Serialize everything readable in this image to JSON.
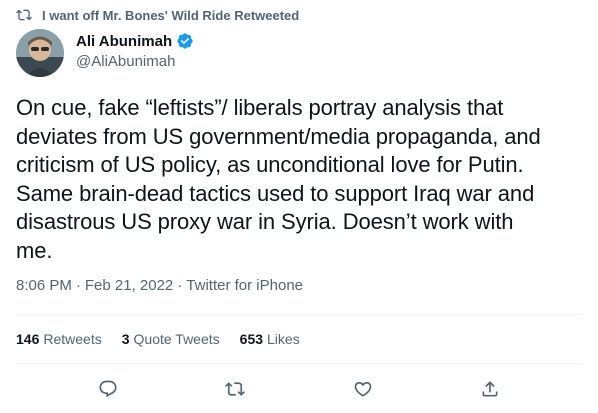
{
  "retweet": {
    "label": "I want off Mr. Bones' Wild Ride Retweeted"
  },
  "author": {
    "display_name": "Ali Abunimah",
    "handle": "@AliAbunimah",
    "verified": true
  },
  "tweet": {
    "text": "On cue, fake “leftists”/ liberals portray analysis that\ndeviates from US government/media propaganda, and\ncriticism of US policy, as unconditional love for Putin.\nSame brain-dead tactics used to support Iraq war and\ndisastrous US proxy war in Syria. Doesn’t work with\nme.",
    "time": "8:06 PM",
    "date": "Feb 21, 2022",
    "source": "Twitter for iPhone",
    "separator": "·"
  },
  "stats": {
    "retweets_count": "146",
    "retweets_label": "Retweets",
    "quotes_count": "3",
    "quotes_label": "Quote Tweets",
    "likes_count": "653",
    "likes_label": "Likes"
  },
  "icons": {
    "retweet_indicator": "retweet-icon",
    "verified": "verified-badge-icon",
    "reply": "reply-icon",
    "retweet": "retweet-icon",
    "like": "heart-icon",
    "share": "share-icon"
  },
  "colors": {
    "text": "#0f1419",
    "secondary": "#536471",
    "verified": "#1d9bf0",
    "divider": "#eff3f4"
  }
}
